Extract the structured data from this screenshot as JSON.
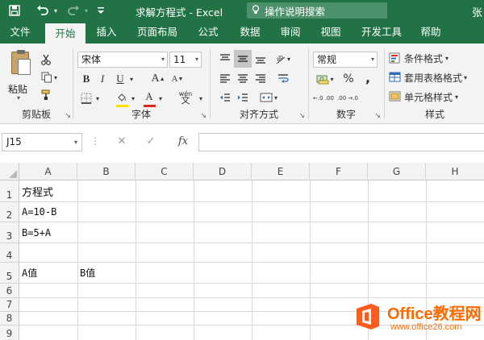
{
  "titlebar": {
    "title": "求解方程式  -  Excel",
    "search_placeholder": "操作说明搜索",
    "user_initial": "张",
    "save_icon": "save-icon",
    "undo_icon": "undo-icon",
    "redo_icon": "redo-icon"
  },
  "tabs": [
    {
      "label": "文件"
    },
    {
      "label": "开始",
      "active": true
    },
    {
      "label": "插入"
    },
    {
      "label": "页面布局"
    },
    {
      "label": "公式"
    },
    {
      "label": "数据"
    },
    {
      "label": "审阅"
    },
    {
      "label": "视图"
    },
    {
      "label": "开发工具"
    },
    {
      "label": "帮助"
    }
  ],
  "ribbon": {
    "clipboard": {
      "label": "剪贴板",
      "paste_label": "粘贴"
    },
    "font": {
      "label": "字体",
      "font_name": "宋体",
      "font_size": "11",
      "bold": "B",
      "italic": "I",
      "underline": "U",
      "grow": "A",
      "shrink": "A",
      "phonetic": "wén",
      "font_color": "A"
    },
    "alignment": {
      "label": "对齐方式"
    },
    "number": {
      "label": "数字",
      "format": "常规",
      "percent": "%",
      "comma": ",",
      "inc_decimal": "←.0 .00",
      "dec_decimal": ".00 →.0"
    },
    "styles": {
      "label": "样式",
      "conditional": "条件格式",
      "table": "套用表格格式",
      "cell_styles": "单元格样式"
    }
  },
  "formula_bar": {
    "name_box": "J15",
    "cancel": "✕",
    "enter": "✓",
    "fx": "fx",
    "content": ""
  },
  "sheet": {
    "columns": [
      "A",
      "B",
      "C",
      "D",
      "E",
      "F",
      "G",
      "H"
    ],
    "rows": [
      "1",
      "2",
      "3",
      "4",
      "5",
      "6",
      "7",
      "8",
      "9"
    ],
    "cells": {
      "A1": "方程式",
      "A2": "A=10-B",
      "A3": "B=5+A",
      "A5": "A值",
      "B5": "B值"
    }
  },
  "watermark": {
    "title": "Office教程网",
    "url": "www.office26.com"
  },
  "colors": {
    "brand_green": "#217346",
    "ribbon_bg": "#f3f3f3",
    "watermark_orange": "#ff6a00"
  }
}
